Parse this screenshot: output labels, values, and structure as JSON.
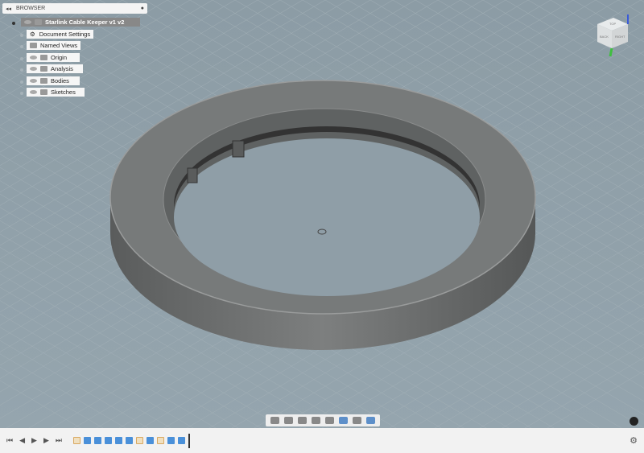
{
  "browser": {
    "title": "BROWSER",
    "root": "Starlink Cable Keeper v1 v2",
    "items": [
      {
        "label": "Document Settings",
        "icon": "gear-icon"
      },
      {
        "label": "Named Views",
        "icon": "folder-icon"
      },
      {
        "label": "Origin",
        "icon": "folder-icon"
      },
      {
        "label": "Analysis",
        "icon": "folder-icon"
      },
      {
        "label": "Bodies",
        "icon": "folder-icon"
      },
      {
        "label": "Sketches",
        "icon": "folder-icon"
      }
    ]
  },
  "viewcube": {
    "faces": [
      "TOP",
      "BACK",
      "RIGHT"
    ]
  },
  "timeline": {
    "controls": [
      "first",
      "previous",
      "play",
      "next",
      "last"
    ],
    "features": [
      "sketch",
      "extrude",
      "extrude",
      "fillet",
      "revolve",
      "revolve",
      "sketch",
      "extrude",
      "sketch",
      "extrude",
      "mirror"
    ]
  },
  "navbar": {
    "tools": [
      "orbit",
      "pan",
      "look",
      "zoom-window",
      "zoom",
      "display-mode",
      "grid",
      "viewports"
    ]
  },
  "colors": {
    "viewport": "#909fa8",
    "body": "#6f7171",
    "accent": "#4a90d9"
  }
}
